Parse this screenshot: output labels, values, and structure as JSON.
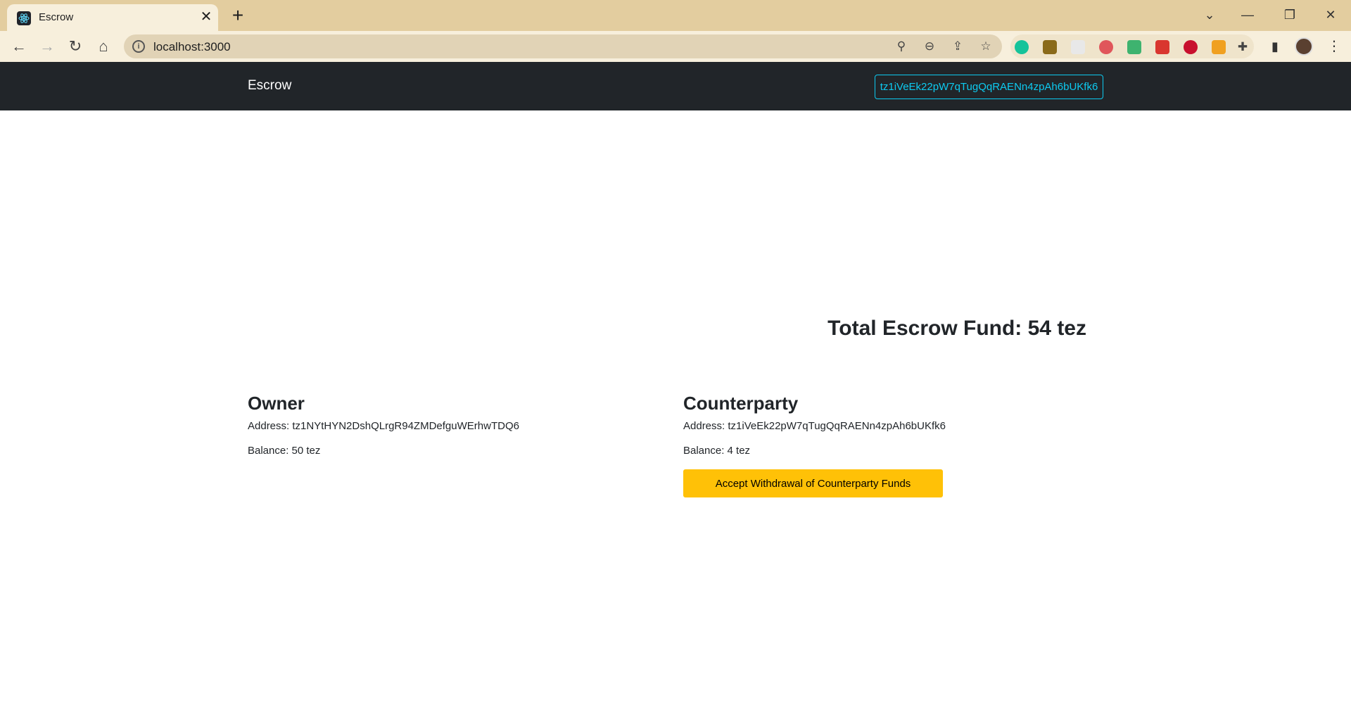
{
  "browser": {
    "tab_title": "Escrow",
    "url": "localhost:3000"
  },
  "app": {
    "brand": "Escrow",
    "wallet_address": "tz1iVeEk22pW7qTugQqRAENn4zpAh6bUKfk6",
    "total_fund": "Total Escrow Fund: 54 tez",
    "owner": {
      "heading": "Owner",
      "address": "Address: tz1NYtHYN2DshQLrgR94ZMDefguWErhwTDQ6",
      "balance": "Balance: 50 tez"
    },
    "counterparty": {
      "heading": "Counterparty",
      "address": "Address: tz1iVeEk22pW7qTugQqRAENn4zpAh6bUKfk6",
      "balance": "Balance: 4 tez",
      "action_label": "Accept Withdrawal of Counterparty Funds"
    }
  },
  "colors": {
    "navbar_bg": "#212529",
    "wallet_outline": "#0dcaf0",
    "accept_button": "#ffc107",
    "chrome_titlebar": "#e3cd9f",
    "chrome_toolbar": "#f7efdc"
  }
}
